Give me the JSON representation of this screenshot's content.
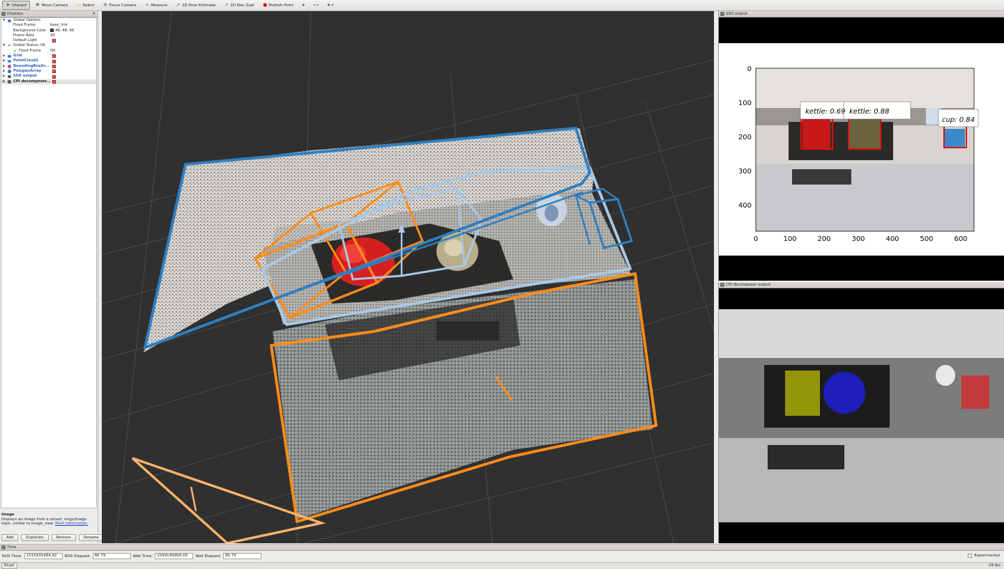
{
  "toolbar": {
    "tools": [
      {
        "label": "Interact",
        "icon": "cursor-icon",
        "active": true
      },
      {
        "label": "Move Camera",
        "icon": "move-camera-icon"
      },
      {
        "label": "Select",
        "icon": "select-icon"
      },
      {
        "label": "Focus Camera",
        "icon": "focus-camera-icon"
      },
      {
        "label": "Measure",
        "icon": "measure-icon"
      },
      {
        "label": "2D Pose Estimate",
        "icon": "pose-estimate-icon"
      },
      {
        "label": "2D Nav Goal",
        "icon": "nav-goal-icon"
      },
      {
        "label": "Publish Point",
        "icon": "publish-point-icon"
      }
    ]
  },
  "displays": {
    "title": "Displays",
    "rows": [
      {
        "label": "Global Options",
        "level": 0,
        "expanded": true,
        "icon": "globe"
      },
      {
        "label": "Fixed Frame",
        "level": 1,
        "value": "base_link"
      },
      {
        "label": "Background Color",
        "level": 1,
        "value": "48; 48; 48",
        "swatch": "#303030"
      },
      {
        "label": "Frame Rate",
        "level": 1,
        "value": "30"
      },
      {
        "label": "Default Light",
        "level": 1,
        "check": true
      },
      {
        "label": "Global Status: Ok",
        "level": 0,
        "expanded": true,
        "icon": "ok"
      },
      {
        "label": "Fixed Frame",
        "level": 1,
        "value": "OK",
        "icon": "ok"
      },
      {
        "label": "Grid",
        "level": 0,
        "collapsed": true,
        "check": true,
        "blue": true,
        "icon": "grid"
      },
      {
        "label": "PointCloud2",
        "level": 0,
        "collapsed": true,
        "check": true,
        "blue": true,
        "icon": "cloud"
      },
      {
        "label": "BoundingBoxAr...",
        "level": 0,
        "collapsed": true,
        "check": true,
        "blue": true,
        "icon": "box"
      },
      {
        "label": "PolygonArray",
        "level": 0,
        "collapsed": true,
        "check": true,
        "blue": true,
        "icon": "poly"
      },
      {
        "label": "SSD output",
        "level": 0,
        "collapsed": true,
        "check": true,
        "blue": true,
        "icon": "image"
      },
      {
        "label": "CPI decomposer...",
        "level": 0,
        "collapsed": true,
        "check": true,
        "selected": true,
        "icon": "image"
      }
    ],
    "description": {
      "heading": "Image",
      "text": "Displays an image from a sensor_msgs/Image topic, similar to image_view.",
      "link": "More Information."
    },
    "buttons": [
      "Add",
      "Duplicate",
      "Remove",
      "Rename"
    ]
  },
  "ssd_panel": {
    "title": "SSD output",
    "y_ticks": [
      "0",
      "100",
      "200",
      "300",
      "400"
    ],
    "x_ticks": [
      "0",
      "100",
      "200",
      "300",
      "400",
      "500",
      "600"
    ],
    "detections": [
      {
        "label": "kettle: 0.69"
      },
      {
        "label": "kettle: 0.88"
      },
      {
        "label": "cup: 0.84"
      }
    ],
    "box_color": "#e01010"
  },
  "cpi_panel": {
    "title": "CPI decomposer output",
    "mask_colors": [
      "#c8c800",
      "#2020ff",
      "#e02020"
    ]
  },
  "colors": {
    "bbox_orange": "#ff8c1a",
    "bbox_light_orange": "#ffb36b",
    "bbox_blue": "#2f7fc1",
    "bbox_light_blue": "#a8c8e8",
    "grid": "#4a4a4a"
  },
  "time": {
    "title": "Time",
    "ros_time_label": "ROS Time:",
    "ros_time": "1515935484.92",
    "ros_elapsed_label": "ROS Elapsed:",
    "ros_elapsed": "86.79",
    "wall_time_label": "Wall Time:",
    "wall_time": "1599149994.09",
    "wall_elapsed_label": "Wall Elapsed:",
    "wall_elapsed": "86.79",
    "experimental_label": "Experimental"
  },
  "status": {
    "reset_label": "Reset",
    "fps": "29 fps"
  }
}
